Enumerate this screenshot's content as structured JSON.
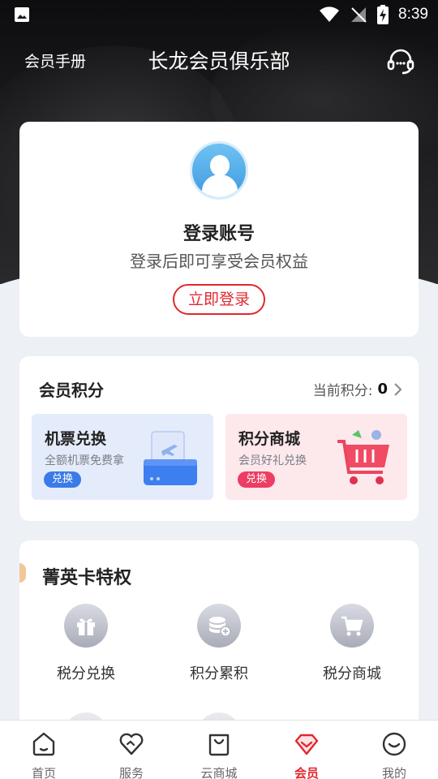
{
  "status_bar": {
    "time": "8:39"
  },
  "header": {
    "left_link": "会员手册",
    "title": "长龙会员俱乐部"
  },
  "login_card": {
    "title": "登录账号",
    "subtitle": "登录后即可享受会员权益",
    "button": "立即登录"
  },
  "points": {
    "title": "会员积分",
    "current_label": "当前积分:",
    "current_value": "0",
    "tiles": [
      {
        "title": "机票兑换",
        "subtitle": "全额机票免费拿",
        "badge": "兑换"
      },
      {
        "title": "积分商城",
        "subtitle": "会员好礼兑换",
        "badge": "兑换"
      }
    ]
  },
  "privileges": {
    "title": "菁英卡特权",
    "items": [
      {
        "label": "税分兑换",
        "icon": "gift-icon"
      },
      {
        "label": "积分累积",
        "icon": "coins-add-icon"
      },
      {
        "label": "税分商城",
        "icon": "cart-icon"
      }
    ]
  },
  "tabbar": {
    "items": [
      {
        "label": "首页",
        "icon": "home-icon"
      },
      {
        "label": "服务",
        "icon": "heart-icon"
      },
      {
        "label": "云商城",
        "icon": "bag-icon"
      },
      {
        "label": "会员",
        "icon": "gem-icon",
        "active": true
      },
      {
        "label": "我的",
        "icon": "smile-icon"
      }
    ]
  },
  "colors": {
    "accent": "#e0282e",
    "blue_tile": "#e4ecfb",
    "pink_tile": "#fde8ec"
  }
}
